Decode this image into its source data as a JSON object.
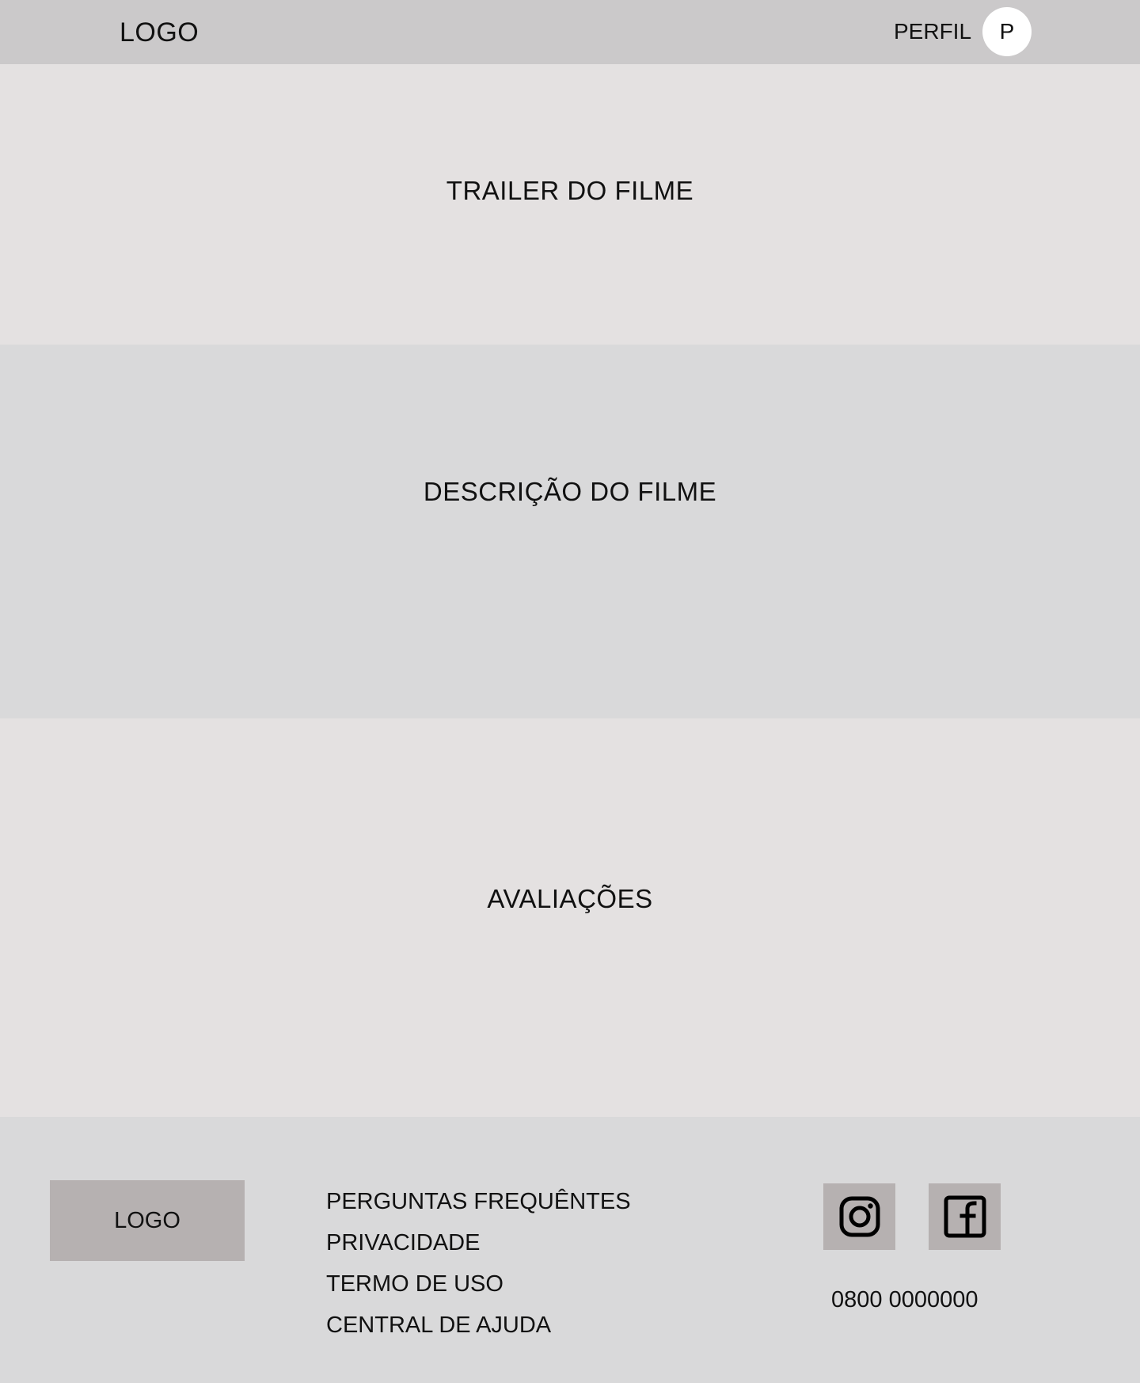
{
  "header": {
    "logo": "LOGO",
    "profile_label": "PERFIL",
    "avatar_initial": "P"
  },
  "sections": {
    "trailer": "TRAILER DO FILME",
    "description": "DESCRIÇÃO DO FILME",
    "reviews": "AVALIAÇÕES"
  },
  "footer": {
    "logo": "LOGO",
    "links": [
      "PERGUNTAS FREQUÊNTES",
      "PRIVACIDADE",
      "TERMO DE USO",
      "CENTRAL DE AJUDA"
    ],
    "social": [
      {
        "icon": "instagram-icon"
      },
      {
        "icon": "facebook-icon"
      }
    ],
    "phone": "0800 0000000"
  },
  "colors": {
    "header_bg": "#cbc9ca",
    "section_light": "#e4e1e1",
    "section_dark": "#d9d9da",
    "placeholder_box": "#b6b1b1",
    "avatar_bg": "#ffffff",
    "text": "#111111"
  }
}
